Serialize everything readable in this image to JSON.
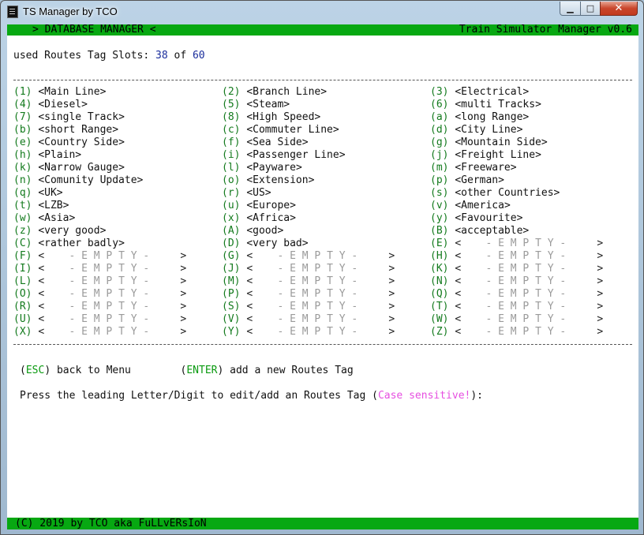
{
  "window": {
    "title": "TS Manager by TCO",
    "min_glyph": "▁",
    "max_glyph": "□",
    "close_glyph": "✕"
  },
  "header": {
    "left": "> DATABASE MANAGER <",
    "right": "Train Simulator Manager v0.6"
  },
  "slots": {
    "label": "used Routes Tag Slots:",
    "used": "38",
    "of": "of",
    "total": "60"
  },
  "tags": [
    {
      "key": "1",
      "name": "Main Line"
    },
    {
      "key": "2",
      "name": "Branch Line"
    },
    {
      "key": "3",
      "name": "Electrical"
    },
    {
      "key": "4",
      "name": "Diesel"
    },
    {
      "key": "5",
      "name": "Steam"
    },
    {
      "key": "6",
      "name": "multi Tracks"
    },
    {
      "key": "7",
      "name": "single Track"
    },
    {
      "key": "8",
      "name": "High Speed"
    },
    {
      "key": "a",
      "name": "long Range"
    },
    {
      "key": "b",
      "name": "short Range"
    },
    {
      "key": "c",
      "name": "Commuter Line"
    },
    {
      "key": "d",
      "name": "City Line"
    },
    {
      "key": "e",
      "name": "Country Side"
    },
    {
      "key": "f",
      "name": "Sea Side"
    },
    {
      "key": "g",
      "name": "Mountain Side"
    },
    {
      "key": "h",
      "name": "Plain"
    },
    {
      "key": "i",
      "name": "Passenger Line"
    },
    {
      "key": "j",
      "name": "Freight Line"
    },
    {
      "key": "k",
      "name": "Narrow Gauge"
    },
    {
      "key": "l",
      "name": "Payware"
    },
    {
      "key": "m",
      "name": "Freeware"
    },
    {
      "key": "n",
      "name": "Comunity Update"
    },
    {
      "key": "o",
      "name": "Extension"
    },
    {
      "key": "p",
      "name": "German"
    },
    {
      "key": "q",
      "name": "UK"
    },
    {
      "key": "r",
      "name": "US"
    },
    {
      "key": "s",
      "name": "other Countries"
    },
    {
      "key": "t",
      "name": "LZB"
    },
    {
      "key": "u",
      "name": "Europe"
    },
    {
      "key": "v",
      "name": "America"
    },
    {
      "key": "w",
      "name": "Asia"
    },
    {
      "key": "x",
      "name": "Africa"
    },
    {
      "key": "y",
      "name": "Favourite"
    },
    {
      "key": "z",
      "name": "very good"
    },
    {
      "key": "A",
      "name": "good"
    },
    {
      "key": "B",
      "name": "acceptable"
    },
    {
      "key": "C",
      "name": "rather badly"
    },
    {
      "key": "D",
      "name": "very bad"
    },
    {
      "key": "E",
      "name": ""
    },
    {
      "key": "F",
      "name": ""
    },
    {
      "key": "G",
      "name": ""
    },
    {
      "key": "H",
      "name": ""
    },
    {
      "key": "I",
      "name": ""
    },
    {
      "key": "J",
      "name": ""
    },
    {
      "key": "K",
      "name": ""
    },
    {
      "key": "L",
      "name": ""
    },
    {
      "key": "M",
      "name": ""
    },
    {
      "key": "N",
      "name": ""
    },
    {
      "key": "O",
      "name": ""
    },
    {
      "key": "P",
      "name": ""
    },
    {
      "key": "Q",
      "name": ""
    },
    {
      "key": "R",
      "name": ""
    },
    {
      "key": "S",
      "name": ""
    },
    {
      "key": "T",
      "name": ""
    },
    {
      "key": "U",
      "name": ""
    },
    {
      "key": "V",
      "name": ""
    },
    {
      "key": "W",
      "name": ""
    },
    {
      "key": "X",
      "name": ""
    },
    {
      "key": "Y",
      "name": ""
    },
    {
      "key": "Z",
      "name": ""
    }
  ],
  "empty_placeholder": "- E M P T Y -",
  "actions": {
    "esc_key": "ESC",
    "esc_label": "back to Menu",
    "enter_key": "ENTER",
    "enter_label": "add a new Routes Tag"
  },
  "prompt": {
    "text": "Press the leading Letter/Digit to edit/add an Routes Tag",
    "open_paren": "(",
    "warning": "Case sensitive!",
    "close": "):"
  },
  "footer": {
    "text": "(C) 2019 by TCO aka FuLLvERsIoN"
  },
  "colors": {
    "bar_green": "#07a812",
    "key_green": "#137a1d",
    "number_blue": "#1a2d9c",
    "warning_pink": "#e64ee0",
    "empty_gray": "#9a9a9a"
  }
}
